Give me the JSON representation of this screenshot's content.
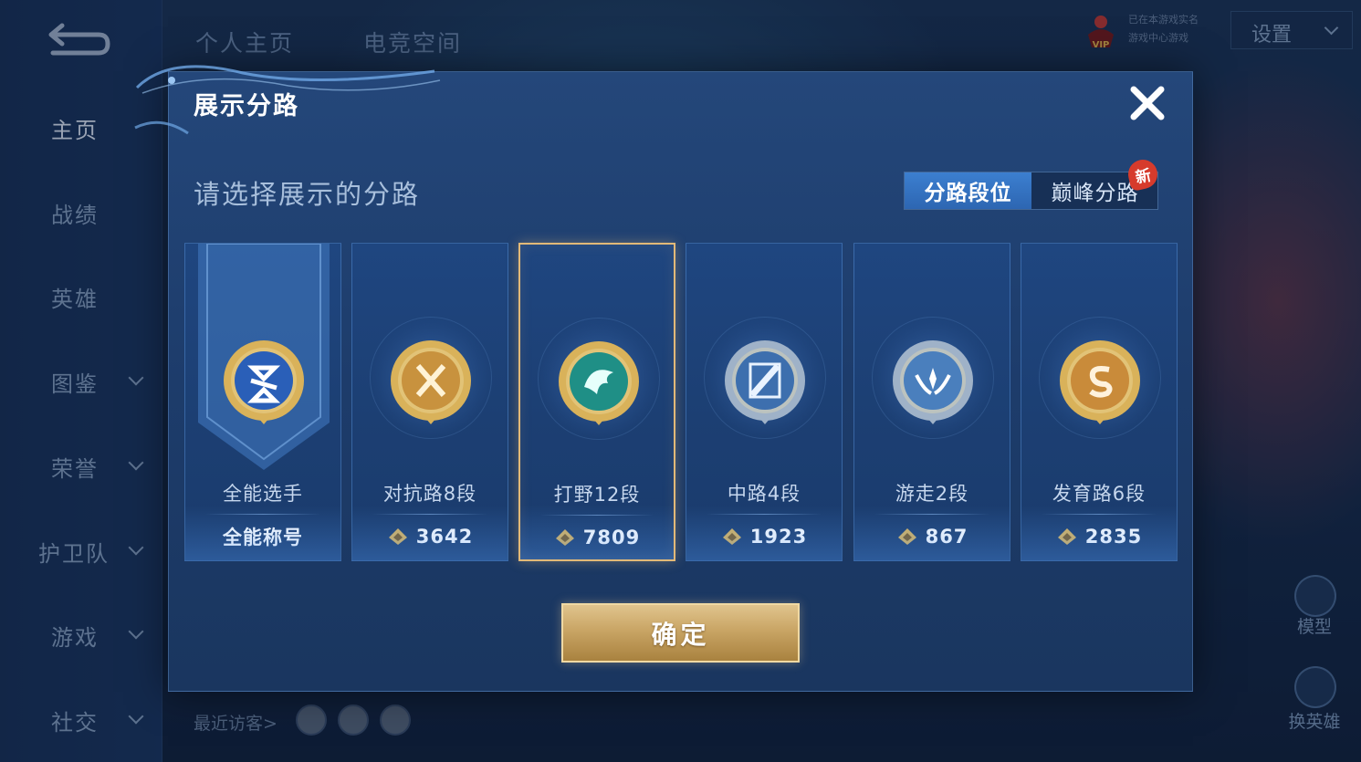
{
  "background": {
    "sidebar": {
      "items": [
        {
          "label": "主页",
          "active": true,
          "expandable": false
        },
        {
          "label": "战绩",
          "active": false,
          "expandable": false
        },
        {
          "label": "英雄",
          "active": false,
          "expandable": false
        },
        {
          "label": "图鉴",
          "active": false,
          "expandable": true
        },
        {
          "label": "荣誉",
          "active": false,
          "expandable": true
        },
        {
          "label": "护卫队",
          "active": false,
          "expandable": true
        },
        {
          "label": "游戏",
          "active": false,
          "expandable": true
        },
        {
          "label": "社交",
          "active": false,
          "expandable": true
        }
      ]
    },
    "tabs": [
      "个人主页",
      "电竞空间"
    ],
    "vip_label": "VIP",
    "vip_text_lines": [
      "已在本游戏实名",
      "游戏中心游戏"
    ],
    "settings_label": "设置",
    "recent_visitors_label": "最近访客>",
    "right_tools": [
      "模型",
      "换英雄"
    ]
  },
  "modal": {
    "title": "展示分路",
    "prompt": "请选择展示的分路",
    "toggle": {
      "active": "分路段位",
      "inactive": "巅峰分路",
      "new_badge": "新"
    },
    "cards": [
      {
        "name": "全能选手",
        "score": "全能称号",
        "show_points_icon": false,
        "badge": "allround",
        "selected": false
      },
      {
        "name": "对抗路8段",
        "score": "3642",
        "show_points_icon": true,
        "badge": "clash",
        "selected": false
      },
      {
        "name": "打野12段",
        "score": "7809",
        "show_points_icon": true,
        "badge": "jungle",
        "selected": true
      },
      {
        "name": "中路4段",
        "score": "1923",
        "show_points_icon": true,
        "badge": "mid",
        "selected": false
      },
      {
        "name": "游走2段",
        "score": "867",
        "show_points_icon": true,
        "badge": "roam",
        "selected": false
      },
      {
        "name": "发育路6段",
        "score": "2835",
        "show_points_icon": true,
        "badge": "farm",
        "selected": false
      }
    ],
    "confirm_label": "确定"
  },
  "colors": {
    "gold": "#e2b978",
    "accent_blue": "#3c7fd0",
    "badge_red": "#d63b2c"
  }
}
